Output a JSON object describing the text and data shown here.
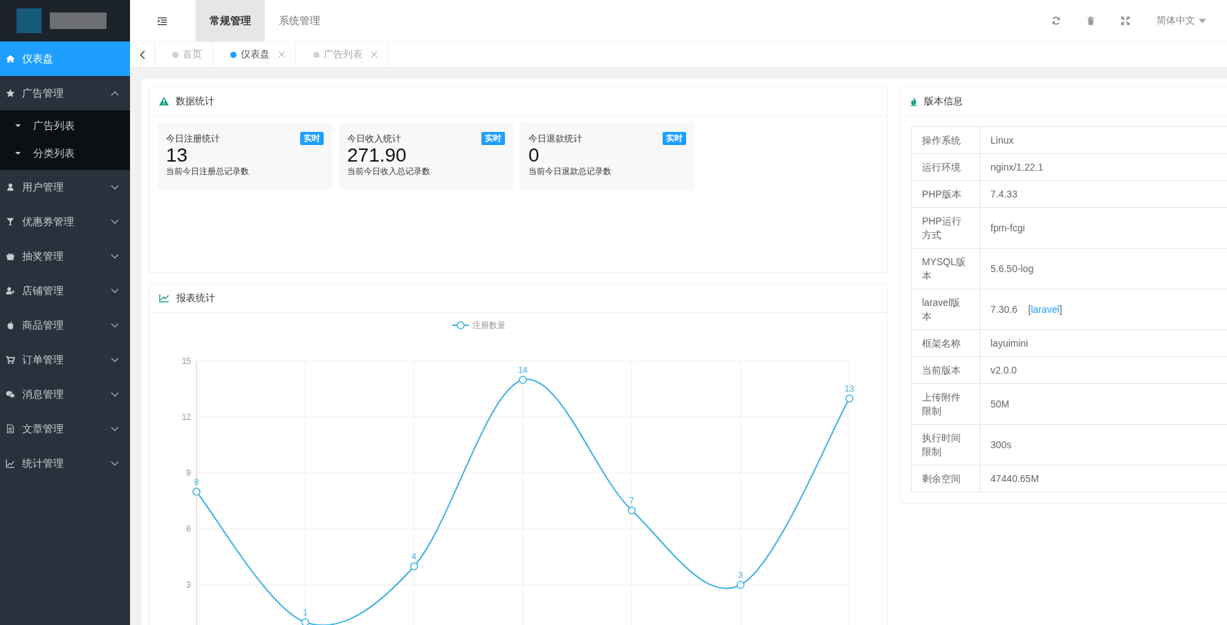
{
  "header": {
    "nav_tabs": [
      {
        "label": "常规管理",
        "selected": true
      },
      {
        "label": "系统管理",
        "selected": false
      }
    ],
    "language": "简体中文"
  },
  "page_tabs": [
    {
      "label": "首页",
      "selected": false,
      "closable": false
    },
    {
      "label": "仪表盘",
      "selected": true,
      "closable": true
    },
    {
      "label": "广告列表",
      "selected": false,
      "closable": true
    }
  ],
  "sidebar": {
    "items": [
      {
        "kind": "link",
        "label": "仪表盘",
        "selected": true
      },
      {
        "kind": "menu",
        "label": "广告管理",
        "selected": false,
        "expanded": true,
        "children": [
          {
            "label": "广告列表"
          },
          {
            "label": "分类列表"
          }
        ]
      },
      {
        "kind": "menu",
        "label": "用户管理",
        "selected": false,
        "expanded": false
      },
      {
        "kind": "menu",
        "label": "优惠券管理",
        "selected": false,
        "expanded": false
      },
      {
        "kind": "menu",
        "label": "抽奖管理",
        "selected": false,
        "expanded": false
      },
      {
        "kind": "menu",
        "label": "店铺管理",
        "selected": false,
        "expanded": false
      },
      {
        "kind": "menu",
        "label": "商品管理",
        "selected": false,
        "expanded": false
      },
      {
        "kind": "menu",
        "label": "订单管理",
        "selected": false,
        "expanded": false
      },
      {
        "kind": "menu",
        "label": "消息管理",
        "selected": false,
        "expanded": false
      },
      {
        "kind": "menu",
        "label": "文章管理",
        "selected": false,
        "expanded": false
      },
      {
        "kind": "menu",
        "label": "统计管理",
        "selected": false,
        "expanded": false
      }
    ]
  },
  "stats": {
    "title": "数据统计",
    "cards": [
      {
        "title": "今日注册统计",
        "badge": "实时",
        "value": "13",
        "caption": "当前今日注册总记录数"
      },
      {
        "title": "今日收入统计",
        "badge": "实时",
        "value": "271.90",
        "caption": "当前今日收入总记录数"
      },
      {
        "title": "今日退款统计",
        "badge": "实时",
        "value": "0",
        "caption": "当前今日退款总记录数"
      }
    ]
  },
  "report": {
    "title": "报表统计",
    "chart_data": {
      "type": "line",
      "series": [
        {
          "name": "注册数量",
          "color": "#3fb1e3",
          "marker": "circle",
          "values": [
            8,
            1,
            4,
            14,
            7,
            3,
            13
          ]
        }
      ],
      "grid": true,
      "ylim": [
        0,
        15
      ],
      "yticks": [
        3,
        6,
        9,
        12,
        15
      ],
      "data_labels": true
    }
  },
  "version": {
    "title": "版本信息",
    "rows": [
      {
        "label": "操作系统",
        "value": "Linux"
      },
      {
        "label": "运行环境",
        "value": "nginx/1.22.1"
      },
      {
        "label": "PHP版本",
        "value": "7.4.33"
      },
      {
        "label": "PHP运行方式",
        "value": "fpm-fcgi"
      },
      {
        "label": "MYSQL版本",
        "value": "5.6.50-log"
      },
      {
        "label": "laravel版本",
        "value": "7.30.6",
        "link_prefix": "[",
        "link": "laravel",
        "link_suffix": "]"
      },
      {
        "label": "框架名称",
        "value": "layuimini"
      },
      {
        "label": "当前版本",
        "value": "v2.0.0"
      },
      {
        "label": "上传附件限制",
        "value": "50M"
      },
      {
        "label": "执行时间限制",
        "value": "300s"
      },
      {
        "label": "剩余空间",
        "value": "47440.65M"
      }
    ]
  }
}
